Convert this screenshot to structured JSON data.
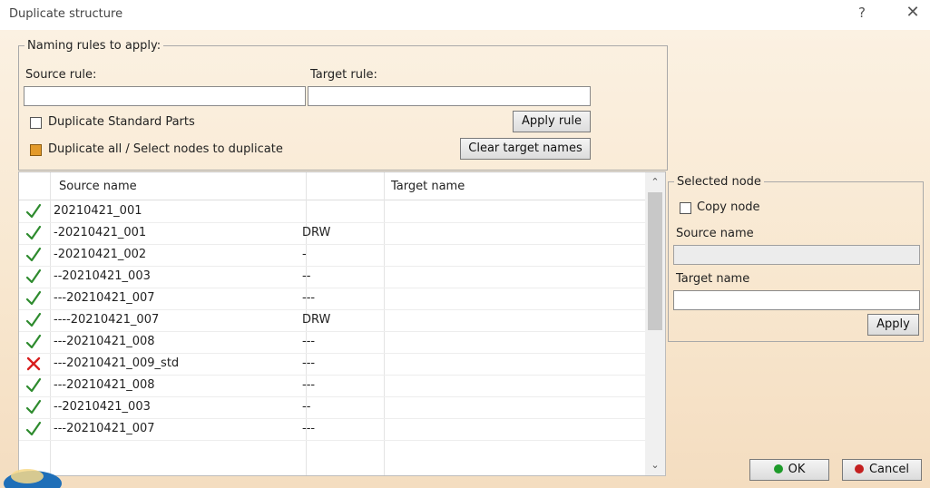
{
  "window": {
    "title": "Duplicate structure",
    "help": "?",
    "close": "✕"
  },
  "naming": {
    "legend": "Naming rules to apply:",
    "source_rule_label": "Source rule:",
    "source_rule_value": "",
    "target_rule_label": "Target rule:",
    "target_rule_value": "",
    "dup_standard_label": "Duplicate Standard Parts",
    "dup_standard_checked": false,
    "dup_all_label": "Duplicate all / Select nodes to duplicate",
    "dup_all_checked": true,
    "apply_rule": "Apply rule",
    "clear_target": "Clear target names"
  },
  "table": {
    "col_source": "Source name",
    "col_target": "Target name",
    "rows": [
      {
        "status": "ok",
        "source": "20210421_001",
        "type": ""
      },
      {
        "status": "ok",
        "source": "-20210421_001",
        "type": "DRW"
      },
      {
        "status": "ok",
        "source": "-20210421_002",
        "type": "-"
      },
      {
        "status": "ok",
        "source": "--20210421_003",
        "type": "--"
      },
      {
        "status": "ok",
        "source": "---20210421_007",
        "type": "---"
      },
      {
        "status": "ok",
        "source": "----20210421_007",
        "type": "DRW"
      },
      {
        "status": "ok",
        "source": "---20210421_008",
        "type": "---"
      },
      {
        "status": "error",
        "source": "---20210421_009_std",
        "type": "---"
      },
      {
        "status": "ok",
        "source": "---20210421_008",
        "type": "---"
      },
      {
        "status": "ok",
        "source": "--20210421_003",
        "type": "--"
      },
      {
        "status": "ok",
        "source": "---20210421_007",
        "type": "---"
      }
    ],
    "scroll_up": "⌃",
    "scroll_down": "⌄"
  },
  "selected_node": {
    "legend": "Selected node",
    "copy_node_label": "Copy node",
    "copy_node_checked": false,
    "source_name_label": "Source name",
    "source_name_value": "",
    "target_name_label": "Target name",
    "target_name_value": "",
    "apply": "Apply"
  },
  "footer": {
    "ok": "OK",
    "cancel": "Cancel"
  },
  "icons": {
    "ok_status": "checkmark-icon",
    "error_status": "cross-icon"
  },
  "colors": {
    "ok": "#2e8b2e",
    "error": "#d81e1e",
    "ok_button_dot": "#1e9b2a",
    "cancel_button_dot": "#c42020"
  }
}
